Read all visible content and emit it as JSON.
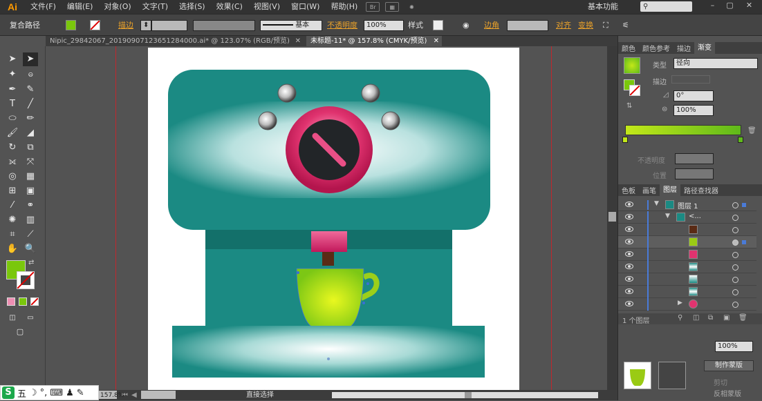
{
  "app": {
    "logo": "Ai"
  },
  "menu": {
    "items": [
      "文件(F)",
      "编辑(E)",
      "对象(O)",
      "文字(T)",
      "选择(S)",
      "效果(C)",
      "视图(V)",
      "窗口(W)",
      "帮助(H)"
    ],
    "br_icon": "Br"
  },
  "workspace": {
    "label": "基本功能"
  },
  "control_bar": {
    "object_type": "复合路径",
    "stroke_label": "描边",
    "stroke_style": "基本",
    "opacity_label": "不透明度",
    "opacity_value": "100%",
    "style_label": "样式",
    "corner_label": "边角",
    "align_label": "对齐",
    "transform_label": "变换",
    "fill_color": "#7ac70c"
  },
  "tabs": [
    {
      "label": "Nipic_29842067_20190907123651284000.ai* @ 123.07% (RGB/预览)",
      "active": false
    },
    {
      "label": "未标题-11* @ 157.8% (CMYK/预览)",
      "active": true
    }
  ],
  "status": {
    "zoom": "157.8%",
    "tool": "直接选择"
  },
  "panels": {
    "top_tabs": [
      "颜色",
      "颜色参考",
      "描边",
      "渐变"
    ],
    "gradient": {
      "type_label": "类型",
      "type_value": "径向",
      "stroke_label": "描边",
      "angle_value": "0°",
      "aspect_value": "100%",
      "opacity_label": "不透明度",
      "position_label": "位置",
      "start_color": "#c3e819",
      "end_color": "#5fb91a"
    },
    "layer_tabs": [
      "色板",
      "画笔",
      "图层",
      "路径查找器"
    ],
    "layers": [
      {
        "name": "图层 1",
        "level": 0
      },
      {
        "name": "<...",
        "level": 1
      },
      {
        "name": "",
        "level": 2
      },
      {
        "name": "",
        "level": 2
      },
      {
        "name": "",
        "level": 2
      },
      {
        "name": "",
        "level": 2
      },
      {
        "name": "",
        "level": 2
      },
      {
        "name": "",
        "level": 2
      },
      {
        "name": "",
        "level": 2
      }
    ],
    "layer_count": "1 个图层",
    "bottom": {
      "opacity_value": "100%",
      "make_mask": "制作蒙版",
      "clip_label": "剪切",
      "invert_label": "反相蒙版"
    }
  },
  "ime": {
    "label": "五"
  },
  "colors": {
    "teal": "#1b8a83",
    "teal_dark": "#13706a",
    "pink": "#e0336f",
    "cup": "#b6df17"
  }
}
